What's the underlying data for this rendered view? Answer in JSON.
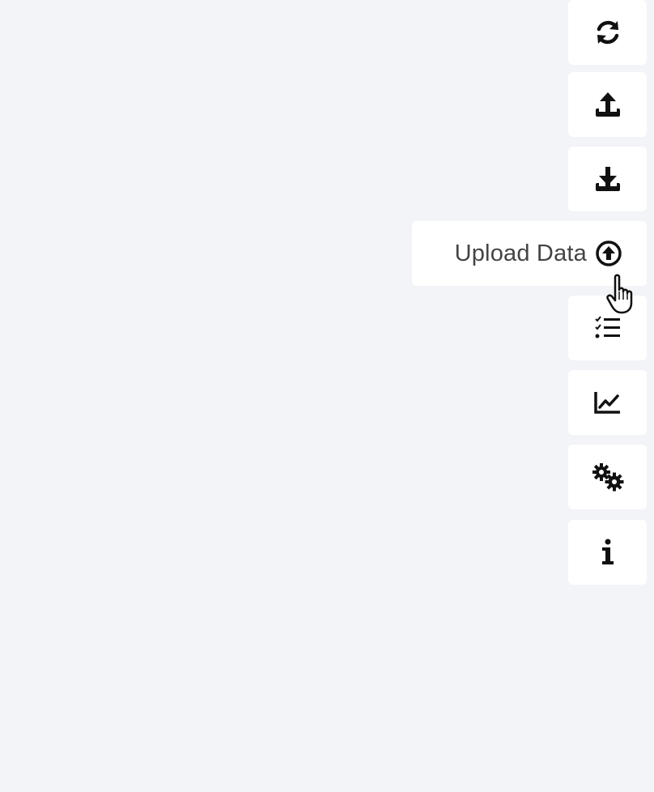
{
  "sidebar": {
    "items": [
      {
        "id": "refresh",
        "icon": "refresh-icon",
        "label": ""
      },
      {
        "id": "upload",
        "icon": "upload-icon",
        "label": ""
      },
      {
        "id": "download",
        "icon": "download-icon",
        "label": ""
      },
      {
        "id": "upload-data",
        "icon": "upload-circle-icon",
        "label": "Upload Data",
        "hovered": true
      },
      {
        "id": "tasks",
        "icon": "checklist-icon",
        "label": ""
      },
      {
        "id": "chart",
        "icon": "line-chart-icon",
        "label": ""
      },
      {
        "id": "settings",
        "icon": "gears-icon",
        "label": ""
      },
      {
        "id": "info",
        "icon": "info-icon",
        "label": ""
      }
    ]
  },
  "colors": {
    "background": "#f3f4f8",
    "button": "#ffffff",
    "icon": "#111111",
    "label": "#444444"
  }
}
